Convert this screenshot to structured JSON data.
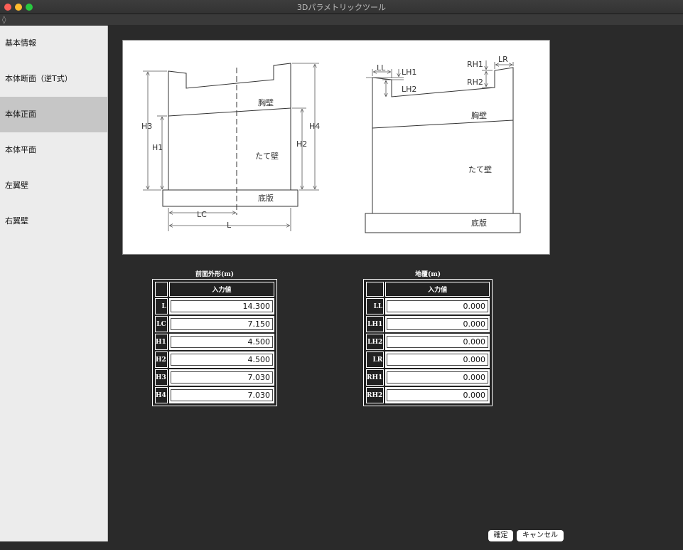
{
  "window": {
    "title": "3Dパラメトリックツール"
  },
  "toolbar": {
    "icon": "◊"
  },
  "sidebar": {
    "items": [
      {
        "label": "基本情報"
      },
      {
        "label": "本体断面（逆T式）"
      },
      {
        "label": "本体正面",
        "selected": true
      },
      {
        "label": "本体平面"
      },
      {
        "label": "左翼壁"
      },
      {
        "label": "右翼壁"
      }
    ]
  },
  "diagram": {
    "labels": {
      "H3": "H3",
      "H1": "H1",
      "H2": "H2",
      "H4": "H4",
      "LC": "LC",
      "L": "L",
      "chest_wall": "胸壁",
      "vertical_wall": "たて壁",
      "base_slab": "底版",
      "LL": "LL",
      "LH1": "LH1",
      "LH2": "LH2",
      "RH1": "RH1",
      "RH2": "RH2",
      "LR": "LR"
    }
  },
  "front_shape": {
    "title": "前面外形(m)",
    "header": "入力値",
    "rows": [
      {
        "label": "L",
        "value": "14.300"
      },
      {
        "label": "LC",
        "value": "7.150"
      },
      {
        "label": "H1",
        "value": "4.500"
      },
      {
        "label": "H2",
        "value": "4.500"
      },
      {
        "label": "H3",
        "value": "7.030"
      },
      {
        "label": "H4",
        "value": "7.030"
      }
    ]
  },
  "cover": {
    "title": "地覆(m)",
    "header": "入力値",
    "rows": [
      {
        "label": "LL",
        "value": "0.000"
      },
      {
        "label": "LH1",
        "value": "0.000"
      },
      {
        "label": "LH2",
        "value": "0.000"
      },
      {
        "label": "LR",
        "value": "0.000"
      },
      {
        "label": "RH1",
        "value": "0.000"
      },
      {
        "label": "RH2",
        "value": "0.000"
      }
    ]
  },
  "buttons": {
    "ok": "確定",
    "cancel": "キャンセル"
  }
}
